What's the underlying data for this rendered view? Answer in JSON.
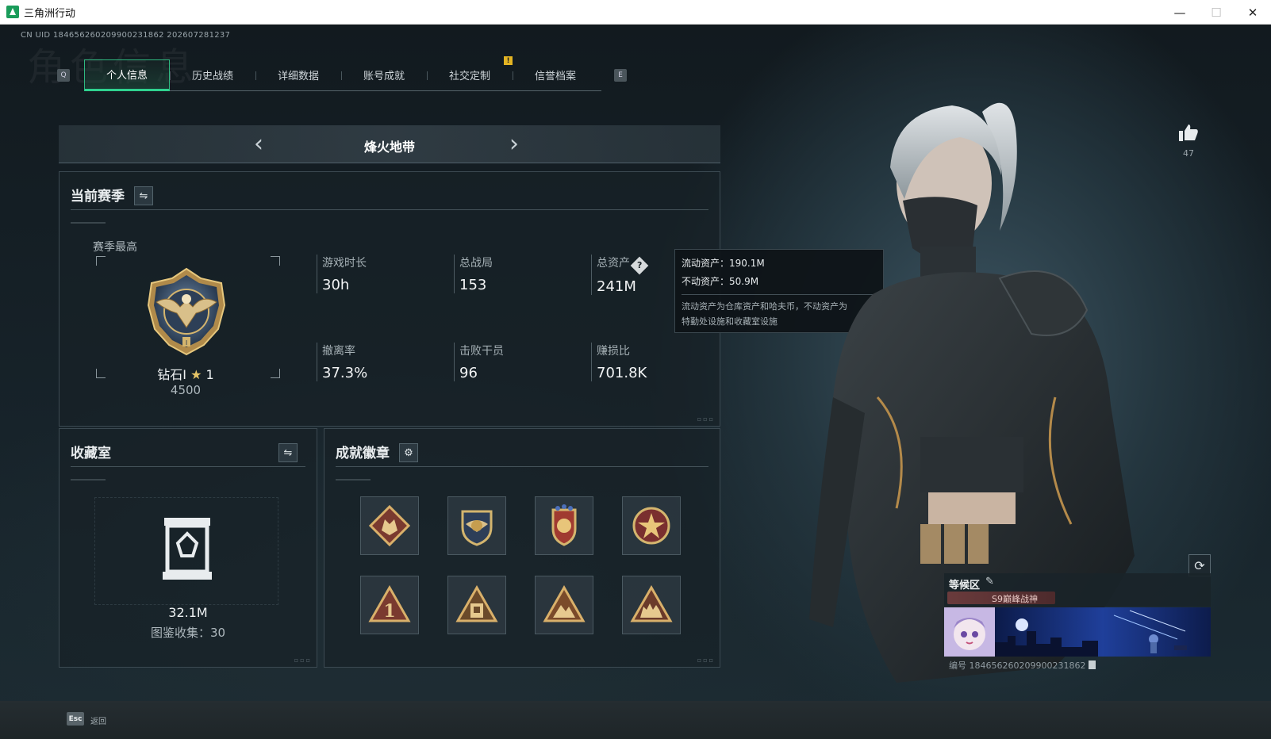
{
  "window": {
    "title": "三角洲行动",
    "controls": {
      "minimize": "—",
      "maximize": "☐",
      "close": "✕"
    }
  },
  "uid_line": "CN UID 1846562602099002318​62 202607281237",
  "watermark": "角色信息",
  "tabs": {
    "prev_key": "Q",
    "next_key": "E",
    "alert": "!",
    "items": [
      "个人信息",
      "历史战绩",
      "详细数据",
      "账号成就",
      "社交定制",
      "信誉档案"
    ],
    "active_index": 0
  },
  "mode": {
    "label": "烽火地带",
    "prev": "‹",
    "next": "›"
  },
  "season": {
    "title": "当前赛季",
    "best_label": "赛季最高",
    "rank_name": "钻石Ⅰ",
    "rank_star": "★",
    "rank_star_count": "1",
    "rank_score": "4500",
    "stats": [
      {
        "label": "游戏时长",
        "value": "30h"
      },
      {
        "label": "总战局",
        "value": "153"
      },
      {
        "label": "总资产",
        "value": "241M",
        "help": "?"
      },
      {
        "label": "撤离率",
        "value": "37.3%"
      },
      {
        "label": "击败干员",
        "value": "96"
      },
      {
        "label": "赚损比",
        "value": "701.8K"
      }
    ]
  },
  "tooltip": {
    "liquid": "流动资产：190.1M",
    "fixed": "不动资产：50.9M",
    "desc_line1": "流动资产为仓库资产和哈夫币，不动资产为",
    "desc_line2": "特勤处设施和收藏室设施"
  },
  "collection": {
    "title": "收藏室",
    "value": "32.1M",
    "count": "图鉴收集：30"
  },
  "badges": {
    "title": "成就徽章",
    "items": [
      "wolf-emblem-badge",
      "eagle-shield-badge",
      "crest-badge",
      "star-medal-badge",
      "number-one-badge",
      "tower-badge",
      "mountain-badge",
      "wolves-badge"
    ]
  },
  "likes": {
    "count": "47"
  },
  "profile_card": {
    "zone": "等候区",
    "title_badge": "S9巅峰战神",
    "id_text": "编号 1846562602099002318​62"
  },
  "footer": {
    "esc_key": "Esc",
    "esc_label": "返回"
  },
  "colors": {
    "accent_green": "#2fd28f",
    "alert_yellow": "#e3b423",
    "gold": "#c9a14a"
  }
}
